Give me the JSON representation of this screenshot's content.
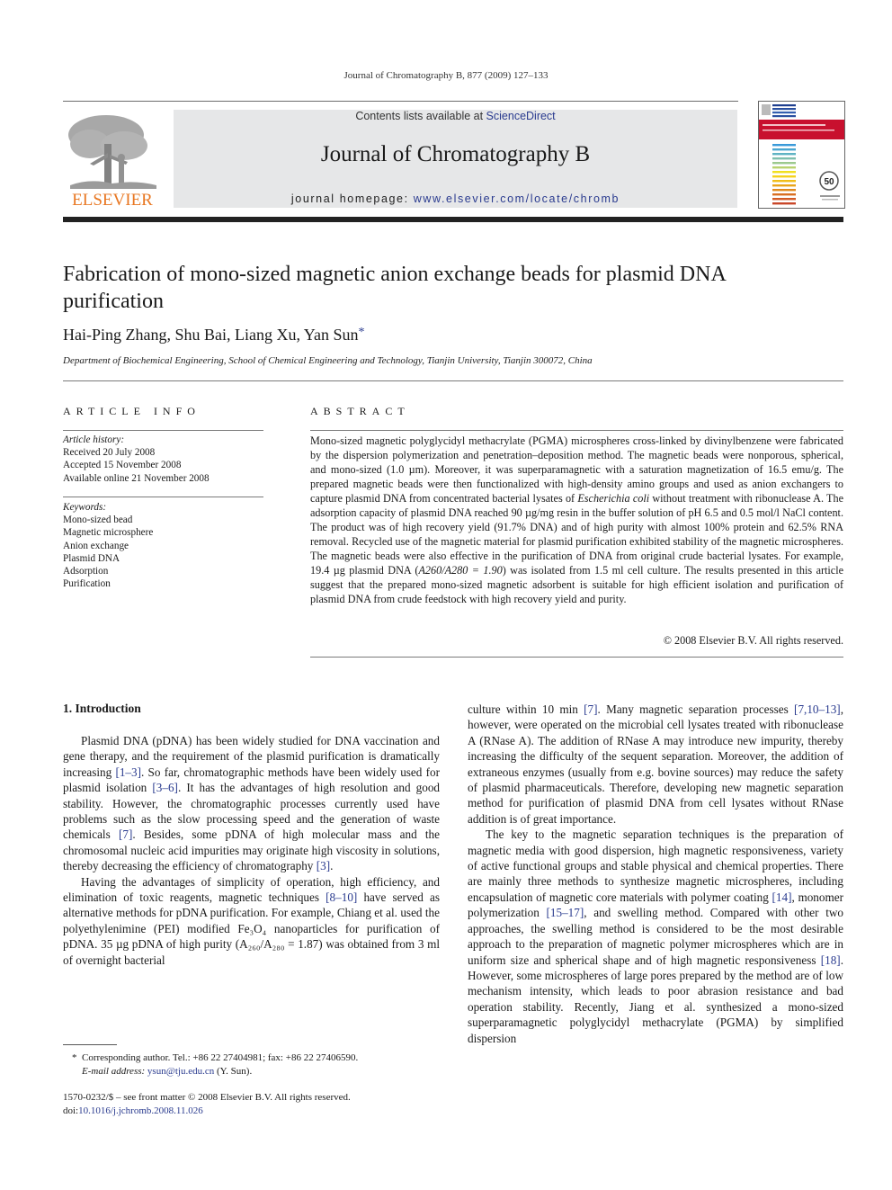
{
  "header": {
    "running_head": "Journal of Chromatography B, 877 (2009) 127–133",
    "contents_prefix": "Contents lists available at ",
    "sciencedirect": "ScienceDirect",
    "journal_title": "Journal of Chromatography B",
    "homepage_prefix": "journal homepage: ",
    "homepage_url": "www.elsevier.com/locate/chromb",
    "publisher_logo_text": "ELSEVIER"
  },
  "colors": {
    "link": "#2a3b8f",
    "elsevier_orange": "#e87722",
    "banner_bg": "#e6e7e8",
    "cover_red": "#c8102e"
  },
  "article": {
    "title": "Fabrication of mono-sized magnetic anion exchange beads for plasmid DNA purification",
    "authors": "Hai-Ping Zhang, Shu Bai, Liang Xu, Yan Sun",
    "corresponding_mark": "*",
    "affiliation": "Department of Biochemical Engineering, School of Chemical Engineering and Technology, Tianjin University, Tianjin 300072, China"
  },
  "article_info": {
    "heading": "ARTICLE INFO",
    "history_label": "Article history:",
    "history": [
      "Received 20 July 2008",
      "Accepted 15 November 2008",
      "Available online 21 November 2008"
    ],
    "keywords_label": "Keywords:",
    "keywords": [
      "Mono-sized bead",
      "Magnetic microsphere",
      "Anion exchange",
      "Plasmid DNA",
      "Adsorption",
      "Purification"
    ]
  },
  "abstract": {
    "heading": "ABSTRACT",
    "part1": "Mono-sized magnetic polyglycidyl methacrylate (PGMA) microspheres cross-linked by divinylbenzene were fabricated by the dispersion polymerization and penetration–deposition method. The magnetic beads were nonporous, spherical, and mono-sized (1.0 µm). Moreover, it was superparamagnetic with a saturation magnetization of 16.5 emu/g. The prepared magnetic beads were then functionalized with high-density amino groups and used as anion exchangers to capture plasmid DNA from concentrated bacterial lysates of ",
    "organism": "Escherichia coli",
    "part2": " without treatment with ribonuclease A. The adsorption capacity of plasmid DNA reached 90 µg/mg resin in the buffer solution of pH 6.5 and 0.5 mol/l NaCl content. The product was of high recovery yield (91.7% DNA) and of high purity with almost 100% protein and 62.5% RNA removal. Recycled use of the magnetic material for plasmid purification exhibited stability of the magnetic microspheres. The magnetic beads were also effective in the purification of DNA from original crude bacterial lysates. For example, 19.4 µg plasmid DNA (",
    "ratio": "A260/A280 = 1.90",
    "part3": ") was isolated from 1.5 ml cell culture. The results presented in this article suggest that the prepared mono-sized magnetic adsorbent is suitable for high efficient isolation and purification of plasmid DNA from crude feedstock with high recovery yield and purity.",
    "copyright": "© 2008 Elsevier B.V. All rights reserved."
  },
  "body": {
    "section_heading": "1.  Introduction",
    "left_p1": [
      "Plasmid DNA (pDNA) has been widely studied for DNA vaccination and gene therapy, and the requirement of the plasmid purification is dramatically increasing ",
      "[1–3]",
      ". So far, chromatographic methods have been widely used for plasmid isolation ",
      "[3–6]",
      ". It has the advantages of high resolution and good stability. However, the chromatographic processes currently used have problems such as the slow processing speed and the generation of waste chemicals ",
      "[7]",
      ". Besides, some pDNA of high molecular mass and the chromosomal nucleic acid impurities may originate high viscosity in solutions, thereby decreasing the efficiency of chromatography ",
      "[3]",
      "."
    ],
    "left_p2": [
      "Having the advantages of simplicity of operation, high efficiency, and elimination of toxic reagents, magnetic techniques ",
      "[8–10]",
      " have served as alternative methods for pDNA purification. For example, Chiang et al. used the polyethylenimine (PEI) modified Fe₃O₄ nanoparticles for purification of pDNA. 35 µg pDNA of high purity (A₂₆₀/A₂₈₀ = 1.87) was obtained from 3 ml of overnight bacterial"
    ],
    "right_p1": [
      "culture within 10 min ",
      "[7]",
      ". Many magnetic separation processes ",
      "[7,10–13]",
      ", however, were operated on the microbial cell lysates treated with ribonuclease A (RNase A). The addition of RNase A may introduce new impurity, thereby increasing the difficulty of the sequent separation. Moreover, the addition of extraneous enzymes (usually from e.g. bovine sources) may reduce the safety of plasmid pharmaceuticals. Therefore, developing new magnetic separation method for purification of plasmid DNA from cell lysates without RNase addition is of great importance."
    ],
    "right_p2": [
      "The key to the magnetic separation techniques is the preparation of magnetic media with good dispersion, high magnetic responsiveness, variety of active functional groups and stable physical and chemical properties. There are mainly three methods to synthesize magnetic microspheres, including encapsulation of magnetic core materials with polymer coating ",
      "[14]",
      ", monomer polymerization ",
      "[15–17]",
      ", and swelling method. Compared with other two approaches, the swelling method is considered to be the most desirable approach to the preparation of magnetic polymer microspheres which are in uniform size and spherical shape and of high magnetic responsiveness ",
      "[18]",
      ". However, some microspheres of large pores prepared by the method are of low mechanism intensity, which leads to poor abrasion resistance and bad operation stability. Recently, Jiang et al. synthesized a mono-sized superparamagnetic polyglycidyl methacrylate (PGMA) by simplified dispersion"
    ]
  },
  "footnote": {
    "mark": "*",
    "text": "Corresponding author. Tel.: +86 22 27404981; fax: +86 22 27406590.",
    "email_label": "E-mail address: ",
    "email": "ysun@tju.edu.cn",
    "email_suffix": " (Y. Sun)."
  },
  "front_matter": {
    "line1": "1570-0232/$ – see front matter © 2008 Elsevier B.V. All rights reserved.",
    "doi_label": "doi:",
    "doi": "10.1016/j.jchromb.2008.11.026"
  }
}
